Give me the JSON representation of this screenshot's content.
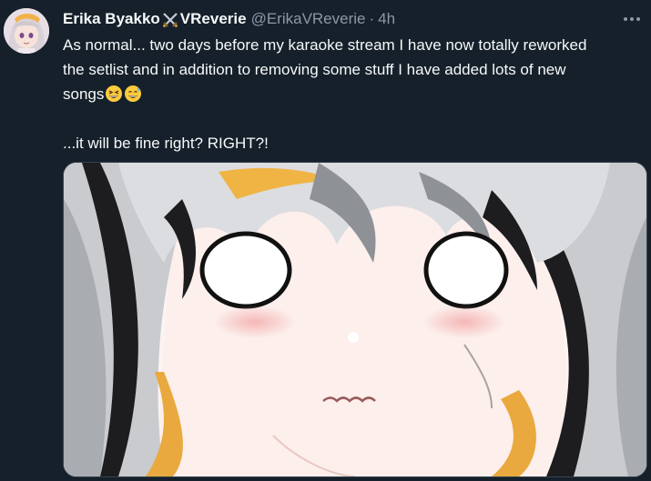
{
  "tweet": {
    "author": {
      "display_name": "Erika Byakko",
      "display_name_suffix": "VReverie",
      "handle": "@ErikaVReverie",
      "separator": "·",
      "timestamp": "4h",
      "avatar_icon": "anime-avatar"
    },
    "text": {
      "line1": "As normal... two days before my karaoke stream I have now totally reworked the setlist and in addition to removing some stuff I have added lots of new songs",
      "line2": "...it will be fine right? RIGHT?!",
      "emojis": [
        "grinning-squinting-face",
        "grinning-face-with-sweat"
      ]
    },
    "more_icon": "more-icon",
    "media": {
      "type": "image",
      "description_icon": "anime-character-shocked-face"
    },
    "colors": {
      "background": "#15202b",
      "primary_text": "#f7f9f9",
      "secondary_text": "#8b98a5"
    }
  }
}
